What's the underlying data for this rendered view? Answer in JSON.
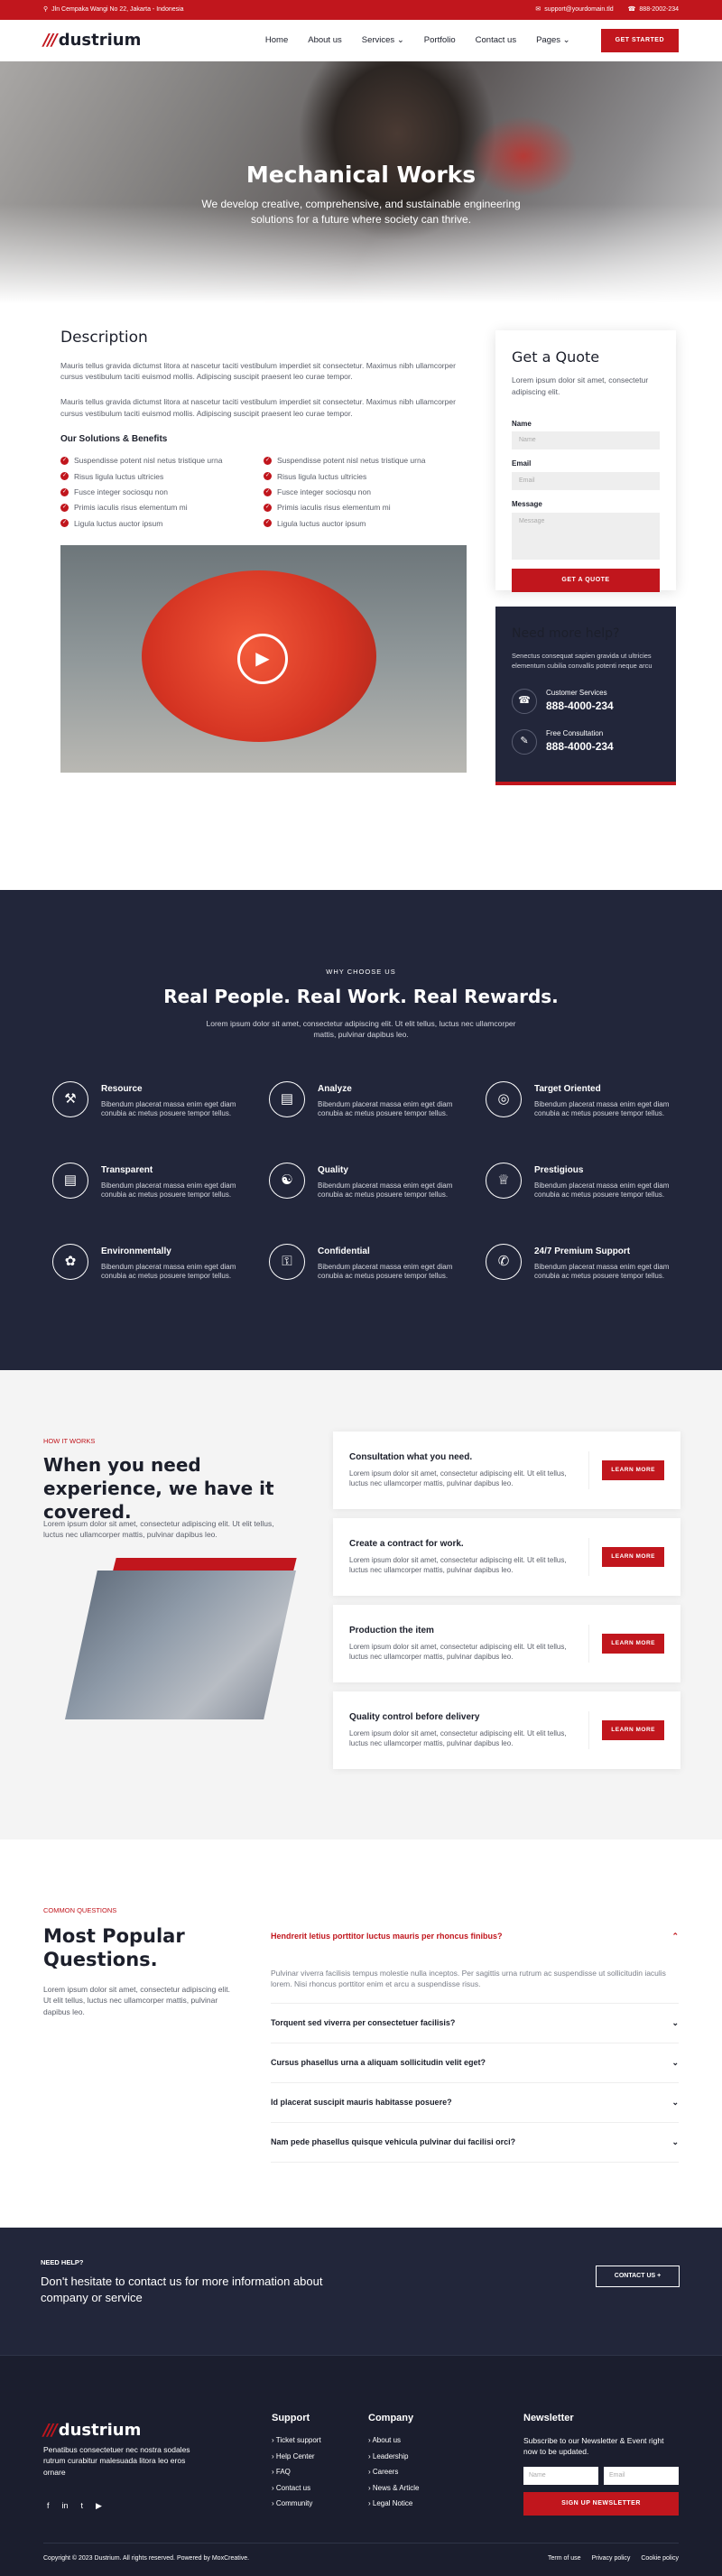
{
  "topbar": {
    "address": "Jln Cempaka Wangi No 22, Jakarta - Indonesia",
    "email": "support@yourdomain.tld",
    "phone": "888-2002-234"
  },
  "nav": {
    "logo": "dustrium",
    "items": [
      "Home",
      "About us",
      "Services",
      "Portfolio",
      "Contact us",
      "Pages"
    ],
    "cta": "GET STARTED"
  },
  "hero": {
    "title": "Mechanical Works",
    "subtitle": "We develop creative, comprehensive, and sustainable engineering solutions for a future where society can thrive."
  },
  "desc": {
    "title": "Description",
    "p1": "Mauris tellus gravida dictumst litora at nascetur taciti vestibulum imperdiet sit consectetur. Maximus nibh ullamcorper cursus vestibulum taciti euismod mollis. Adipiscing suscipit praesent leo curae tempor.",
    "p2": "Mauris tellus gravida dictumst litora at nascetur taciti vestibulum imperdiet sit consectetur. Maximus nibh ullamcorper cursus vestibulum taciti euismod mollis. Adipiscing suscipit praesent leo curae tempor.",
    "solutions_title": "Our Solutions & Benefits",
    "bullets": [
      "Suspendisse potent nisl netus tristique urna",
      "Suspendisse potent nisl netus tristique urna",
      "Risus ligula luctus ultricies",
      "Risus ligula luctus ultricies",
      "Fusce integer sociosqu non",
      "Fusce integer sociosqu non",
      "Primis iaculis risus elementum mi",
      "Primis iaculis risus elementum mi",
      "Ligula luctus auctor ipsum",
      "Ligula luctus auctor ipsum"
    ]
  },
  "quote": {
    "title": "Get a Quote",
    "text": "Lorem ipsum dolor sit amet, consectetur adipiscing elit.",
    "name_label": "Name",
    "name_ph": "Name",
    "email_label": "Email",
    "email_ph": "Email",
    "msg_label": "Message",
    "msg_ph": "Message",
    "button": "GET A QUOTE"
  },
  "help": {
    "title": "Need more help?",
    "text": "Senectus consequat sapien gravida ut ultricies elementum cubilia convallis potenti neque arcu",
    "support_label": "Customer Services",
    "support_phone": "888-4000-234",
    "consult_label": "Free Consultation",
    "consult_phone": "888-4000-234"
  },
  "why": {
    "small": "WHY CHOOSE US",
    "title": "Real People. Real Work. Real Rewards.",
    "subtitle": "Lorem ipsum dolor sit amet, consectetur adipiscing elit. Ut elit tellus, luctus nec ullamcorper mattis, pulvinar dapibus leo.",
    "features": [
      {
        "title": "Resource",
        "text": "Bibendum placerat massa enim eget diam conubia ac metus posuere tempor tellus.",
        "icon": "tools-icon"
      },
      {
        "title": "Analyze",
        "text": "Bibendum placerat massa enim eget diam conubia ac metus posuere tempor tellus.",
        "icon": "chart-icon"
      },
      {
        "title": "Target Oriented",
        "text": "Bibendum placerat massa enim eget diam conubia ac metus posuere tempor tellus.",
        "icon": "target-icon"
      },
      {
        "title": "Transparent",
        "text": "Bibendum placerat massa enim eget diam conubia ac metus posuere tempor tellus.",
        "icon": "document-icon"
      },
      {
        "title": "Quality",
        "text": "Bibendum placerat massa enim eget diam conubia ac metus posuere tempor tellus.",
        "icon": "network-icon"
      },
      {
        "title": "Prestigious",
        "text": "Bibendum placerat massa enim eget diam conubia ac metus posuere tempor tellus.",
        "icon": "trophy-icon"
      },
      {
        "title": "Environmentally",
        "text": "Bibendum placerat massa enim eget diam conubia ac metus posuere tempor tellus.",
        "icon": "leaf-icon"
      },
      {
        "title": "Confidential",
        "text": "Bibendum placerat massa enim eget diam conubia ac metus posuere tempor tellus.",
        "icon": "lock-icon"
      },
      {
        "title": "24/7 Premium Support",
        "text": "Bibendum placerat massa enim eget diam conubia ac metus posuere tempor tellus.",
        "icon": "support-icon"
      }
    ]
  },
  "how": {
    "small": "HOW IT WORKS",
    "title": "When you need experience, we have it covered.",
    "subtitle": "Lorem ipsum dolor sit amet, consectetur adipiscing elit. Ut elit tellus, luctus nec ullamcorper mattis, pulvinar dapibus leo.",
    "steps": [
      {
        "title": "Consultation what you need.",
        "text": "Lorem ipsum dolor sit amet, consectetur adipiscing elit. Ut elit tellus, luctus nec ullamcorper mattis, pulvinar dapibus leo."
      },
      {
        "title": "Create a contract for work.",
        "text": "Lorem ipsum dolor sit amet, consectetur adipiscing elit. Ut elit tellus, luctus nec ullamcorper mattis, pulvinar dapibus leo."
      },
      {
        "title": "Production the item",
        "text": "Lorem ipsum dolor sit amet, consectetur adipiscing elit. Ut elit tellus, luctus nec ullamcorper mattis, pulvinar dapibus leo."
      },
      {
        "title": "Quality control before delivery",
        "text": "Lorem ipsum dolor sit amet, consectetur adipiscing elit. Ut elit tellus, luctus nec ullamcorper mattis, pulvinar dapibus leo."
      }
    ],
    "button": "LEARN MORE"
  },
  "faq": {
    "small": "COMMON QUESTIONS",
    "title": "Most Popular Questions.",
    "subtitle": "Lorem ipsum dolor sit amet, consectetur adipiscing elit. Ut elit tellus, luctus nec ullamcorper mattis, pulvinar dapibus leo.",
    "open_q": "Hendrerit letius porttitor luctus mauris per rhoncus finibus?",
    "open_a": "Pulvinar viverra facilisis tempus molestie nulla inceptos. Per sagittis urna rutrum ac suspendisse ut sollicitudin iaculis lorem. Nisi rhoncus porttitor enim et arcu a suspendisse risus.",
    "questions": [
      "Torquent sed viverra per consectetuer facilisis?",
      "Cursus phasellus urna a aliquam sollicitudin velit eget?",
      "Id placerat suscipit mauris habitasse posuere?",
      "Nam pede phasellus quisque vehicula pulvinar dui facilisi orci?"
    ]
  },
  "cta": {
    "small": "NEED HELP?",
    "text": "Don't hesitate to contact us for more information about company or service",
    "button": "CONTACT US +"
  },
  "footer": {
    "logo": "dustrium",
    "about": "Penatibus consectetuer nec nostra sodales rutrum curabitur malesuada litora leo eros ornare",
    "support_title": "Support",
    "support": [
      "Ticket support",
      "Help Center",
      "FAQ",
      "Contact us",
      "Community"
    ],
    "company_title": "Company",
    "company": [
      "About us",
      "Leadership",
      "Careers",
      "News & Article",
      "Legal Notice"
    ],
    "newsletter_title": "Newsletter",
    "newsletter_text": "Subscribe to our Newsletter & Event right now to be updated.",
    "name_ph": "Name",
    "email_ph": "Email",
    "newsletter_button": "SIGN UP NEWSLETTER",
    "copyright": "Copyright © 2023 Dustrium. All rights reserved. Powered by MoxCreative.",
    "legal": [
      "Term of use",
      "Privacy policy",
      "Cookie policy"
    ]
  }
}
